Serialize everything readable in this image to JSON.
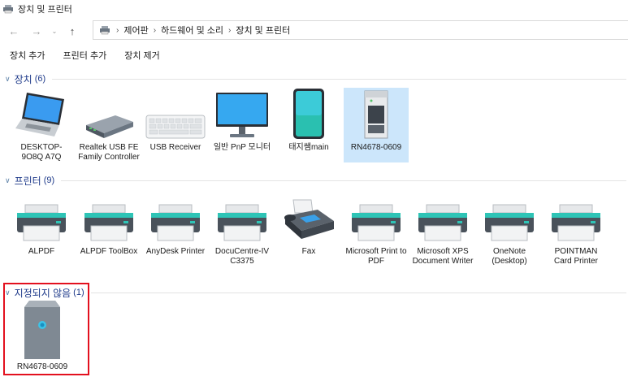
{
  "window": {
    "title": "장치 및 프린터"
  },
  "nav": {
    "back": "←",
    "forward": "→",
    "recent": "⌄",
    "up": "↑"
  },
  "breadcrumb": [
    {
      "label": "제어판"
    },
    {
      "label": "하드웨어 및 소리"
    },
    {
      "label": "장치 및 프린터"
    }
  ],
  "breadcrumb_sep": "›",
  "commands": [
    {
      "label": "장치 추가"
    },
    {
      "label": "프린터 추가"
    },
    {
      "label": "장치 제거"
    }
  ],
  "groups": {
    "devices": {
      "name": "장치",
      "count": "(6)",
      "items": [
        {
          "label": "DESKTOP-9O8Q A7Q",
          "icon": "laptop-icon"
        },
        {
          "label": "Realtek USB FE Family Controller",
          "icon": "network-adapter-icon"
        },
        {
          "label": "USB Receiver",
          "icon": "keyboard-icon"
        },
        {
          "label": "일반 PnP 모니터",
          "icon": "monitor-icon"
        },
        {
          "label": "태지쌤main",
          "icon": "phone-icon"
        },
        {
          "label": "RN4678-0609",
          "icon": "bluetooth-device-icon"
        }
      ]
    },
    "printers": {
      "name": "프린터",
      "count": "(9)",
      "items": [
        {
          "label": "ALPDF",
          "icon": "printer-icon"
        },
        {
          "label": "ALPDF ToolBox",
          "icon": "printer-icon"
        },
        {
          "label": "AnyDesk Printer",
          "icon": "printer-icon"
        },
        {
          "label": "DocuCentre-IV C3375",
          "icon": "printer-icon"
        },
        {
          "label": "Fax",
          "icon": "fax-icon"
        },
        {
          "label": "Microsoft Print to PDF",
          "icon": "printer-icon"
        },
        {
          "label": "Microsoft XPS Document Writer",
          "icon": "printer-icon"
        },
        {
          "label": "OneNote (Desktop)",
          "icon": "printer-icon"
        },
        {
          "label": "POINTMAN Card Printer",
          "icon": "printer-icon"
        }
      ]
    },
    "unspecified": {
      "name": "지정되지 않음",
      "count": "(1)",
      "items": [
        {
          "label": "RN4678-0609",
          "icon": "unspecified-device-icon"
        }
      ]
    }
  },
  "colors": {
    "accent": "#1e3a8a",
    "selection": "#cce6fb",
    "highlight_box": "#e3101e"
  }
}
